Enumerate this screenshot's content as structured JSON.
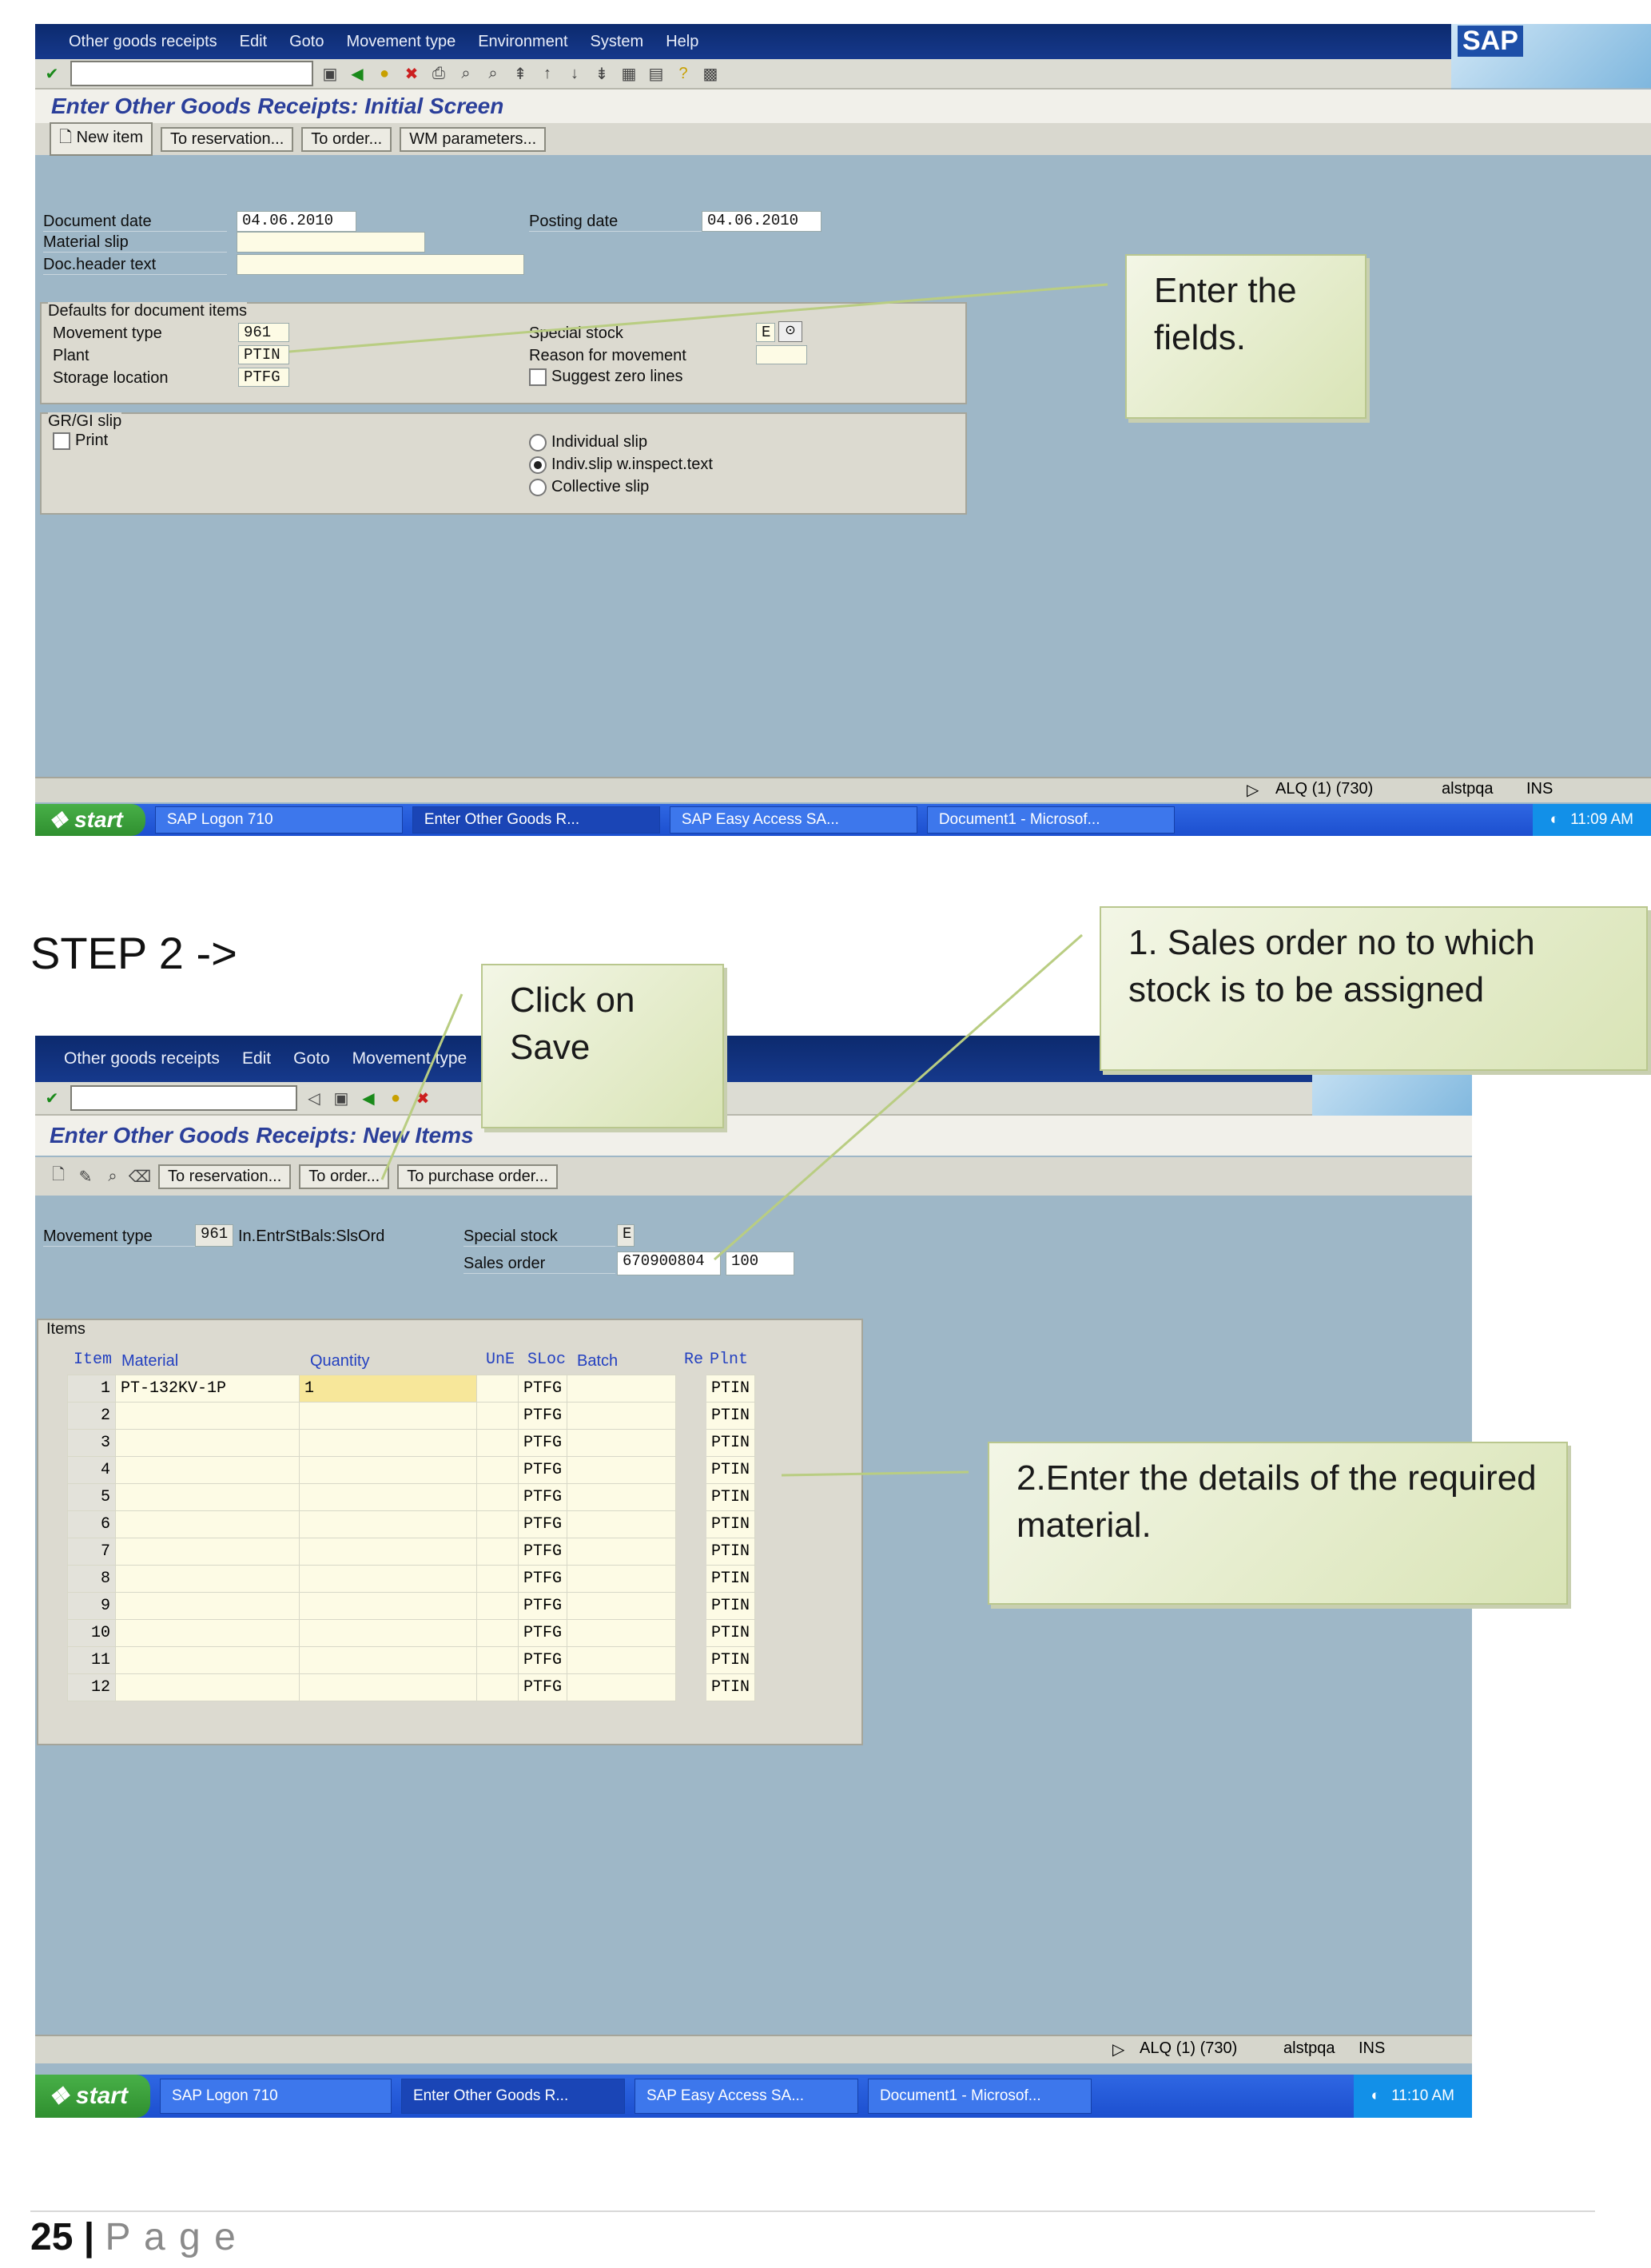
{
  "step2_heading": "STEP 2 ->",
  "footer": {
    "page_number": "25",
    "separator": "|",
    "page_word": "P a g e"
  },
  "screen1": {
    "menu": [
      "Other goods receipts",
      "Edit",
      "Goto",
      "Movement type",
      "Environment",
      "System",
      "Help"
    ],
    "title": "Enter Other Goods Receipts: Initial Screen",
    "buttons": [
      "New item",
      "To reservation...",
      "To order...",
      "WM parameters..."
    ],
    "fields": {
      "document_date_label": "Document date",
      "document_date": "04.06.2010",
      "posting_date_label": "Posting date",
      "posting_date": "04.06.2010",
      "material_slip_label": "Material slip",
      "doc_header_text_label": "Doc.header text"
    },
    "defaults_group": {
      "title": "Defaults for document items",
      "movement_type_label": "Movement type",
      "movement_type": "961",
      "plant_label": "Plant",
      "plant": "PTIN",
      "storage_location_label": "Storage location",
      "storage_location": "PTFG",
      "special_stock_label": "Special stock",
      "special_stock": "E",
      "reason_label": "Reason for movement",
      "suggest_zero_label": "Suggest zero lines"
    },
    "slip_group": {
      "title": "GR/GI slip",
      "print_label": "Print",
      "individual_slip": "Individual slip",
      "indiv_inspect": "Indiv.slip w.inspect.text",
      "collective_slip": "Collective slip",
      "selected": "indiv_inspect"
    },
    "status": {
      "system": "ALQ (1) (730)",
      "user": "alstpqa",
      "mode": "INS"
    },
    "taskbar": {
      "start": "start",
      "tasks": [
        "SAP Logon 710",
        "Enter Other Goods R...",
        "SAP Easy Access  SA...",
        "Document1 - Microsof..."
      ],
      "time": "11:09 AM"
    },
    "callout": "Enter the fields."
  },
  "screen2": {
    "menu": [
      "Other goods receipts",
      "Edit",
      "Goto",
      "Movement type"
    ],
    "title": "Enter Other Goods Receipts: New Items",
    "buttons": [
      "To reservation...",
      "To order...",
      "To purchase order..."
    ],
    "movement_type_label": "Movement type",
    "movement_type": "961",
    "movement_type_desc": "In.EntrStBals:SlsOrd",
    "special_stock_label": "Special stock",
    "special_stock": "E",
    "sales_order_label": "Sales order",
    "sales_order": "670900804",
    "sales_order_item": "100",
    "items_group_title": "Items",
    "columns": [
      "Item",
      "Material",
      "Quantity",
      "UnE",
      "SLoc",
      "Batch",
      "Re",
      "Plnt"
    ],
    "rows": [
      {
        "item": "1",
        "material": "PT-132KV-1P",
        "quantity": "1",
        "sloc": "PTFG",
        "plnt": "PTIN"
      },
      {
        "item": "2",
        "material": "",
        "quantity": "",
        "sloc": "PTFG",
        "plnt": "PTIN"
      },
      {
        "item": "3",
        "material": "",
        "quantity": "",
        "sloc": "PTFG",
        "plnt": "PTIN"
      },
      {
        "item": "4",
        "material": "",
        "quantity": "",
        "sloc": "PTFG",
        "plnt": "PTIN"
      },
      {
        "item": "5",
        "material": "",
        "quantity": "",
        "sloc": "PTFG",
        "plnt": "PTIN"
      },
      {
        "item": "6",
        "material": "",
        "quantity": "",
        "sloc": "PTFG",
        "plnt": "PTIN"
      },
      {
        "item": "7",
        "material": "",
        "quantity": "",
        "sloc": "PTFG",
        "plnt": "PTIN"
      },
      {
        "item": "8",
        "material": "",
        "quantity": "",
        "sloc": "PTFG",
        "plnt": "PTIN"
      },
      {
        "item": "9",
        "material": "",
        "quantity": "",
        "sloc": "PTFG",
        "plnt": "PTIN"
      },
      {
        "item": "10",
        "material": "",
        "quantity": "",
        "sloc": "PTFG",
        "plnt": "PTIN"
      },
      {
        "item": "11",
        "material": "",
        "quantity": "",
        "sloc": "PTFG",
        "plnt": "PTIN"
      },
      {
        "item": "12",
        "material": "",
        "quantity": "",
        "sloc": "PTFG",
        "plnt": "PTIN"
      }
    ],
    "status": {
      "system": "ALQ (1) (730)",
      "user": "alstpqa",
      "mode": "INS"
    },
    "taskbar": {
      "start": "start",
      "tasks": [
        "SAP Logon 710",
        "Enter Other Goods R...",
        "SAP Easy Access  SA...",
        "Document1 - Microsof..."
      ],
      "time": "11:10 AM"
    },
    "callouts": {
      "save": "Click on Save",
      "sales_order": "1. Sales order no to which stock is to be assigned",
      "material": "2.Enter the details of the required material."
    }
  },
  "sap_logo_text": "SAP"
}
